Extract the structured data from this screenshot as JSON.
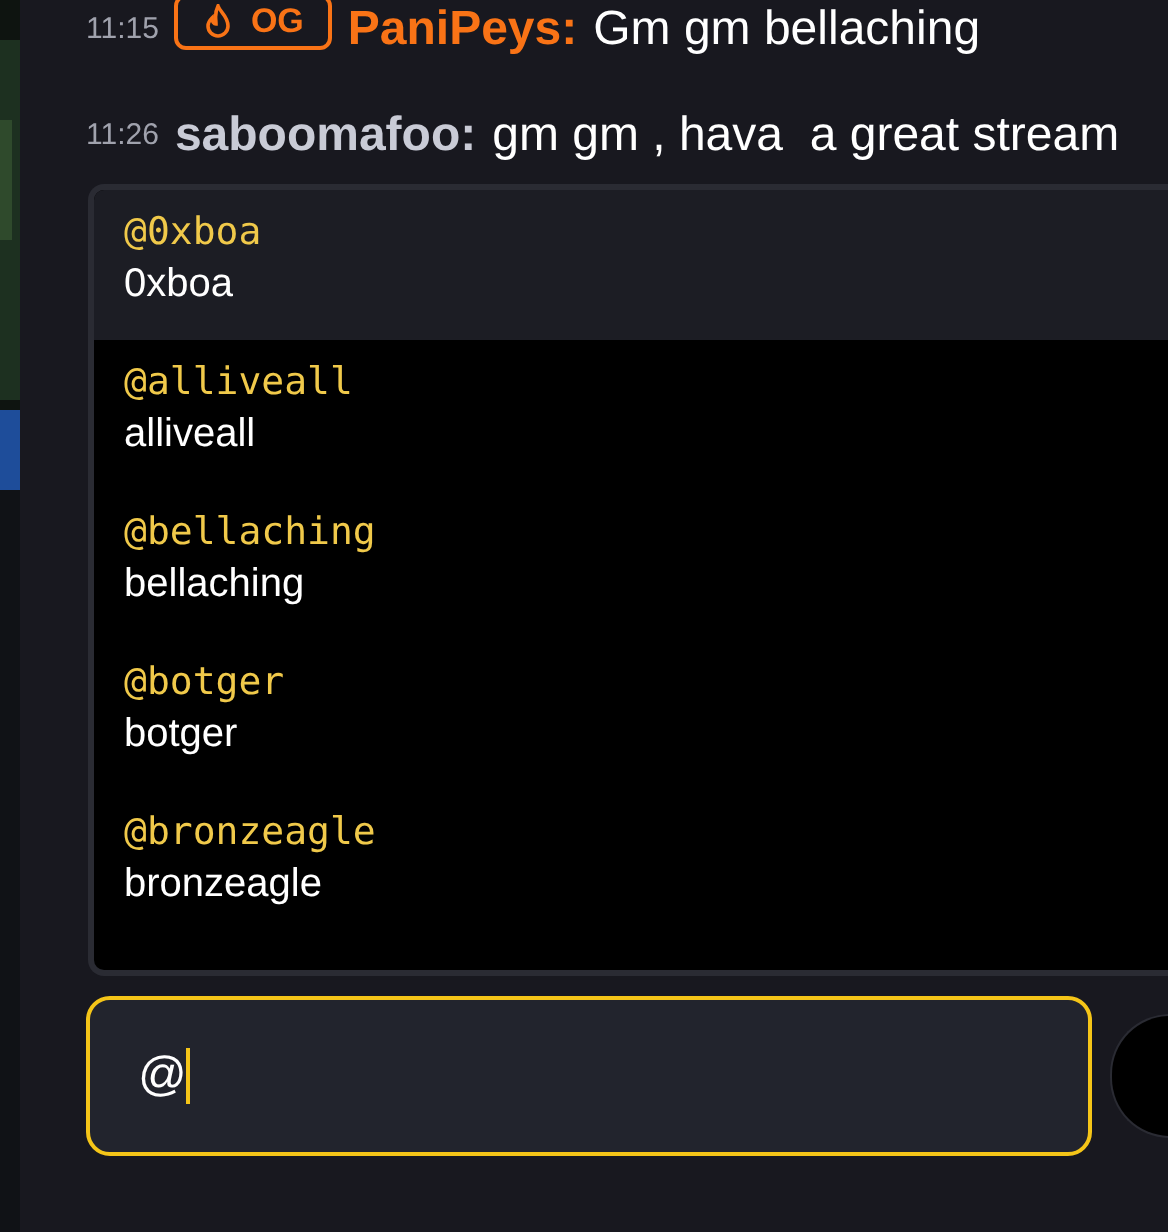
{
  "messages": [
    {
      "time": "11:15",
      "badge": {
        "label": "OG"
      },
      "user": "PaniPeys:",
      "color": "#f97316",
      "text": "Gm gm bellaching"
    },
    {
      "time": "11:26",
      "user": "saboomafoo:",
      "color": "#c9cbd6",
      "text": "gm gm , hava  a great stream"
    }
  ],
  "suggestions": [
    {
      "handle": "@0xboa",
      "name": "0xboa",
      "selected": true
    },
    {
      "handle": "@alliveall",
      "name": "alliveall",
      "selected": false
    },
    {
      "handle": "@bellaching",
      "name": "bellaching",
      "selected": false
    },
    {
      "handle": "@botger",
      "name": "botger",
      "selected": false
    },
    {
      "handle": "@bronzeagle",
      "name": "bronzeagle",
      "selected": false
    }
  ],
  "input": {
    "value": "@"
  }
}
